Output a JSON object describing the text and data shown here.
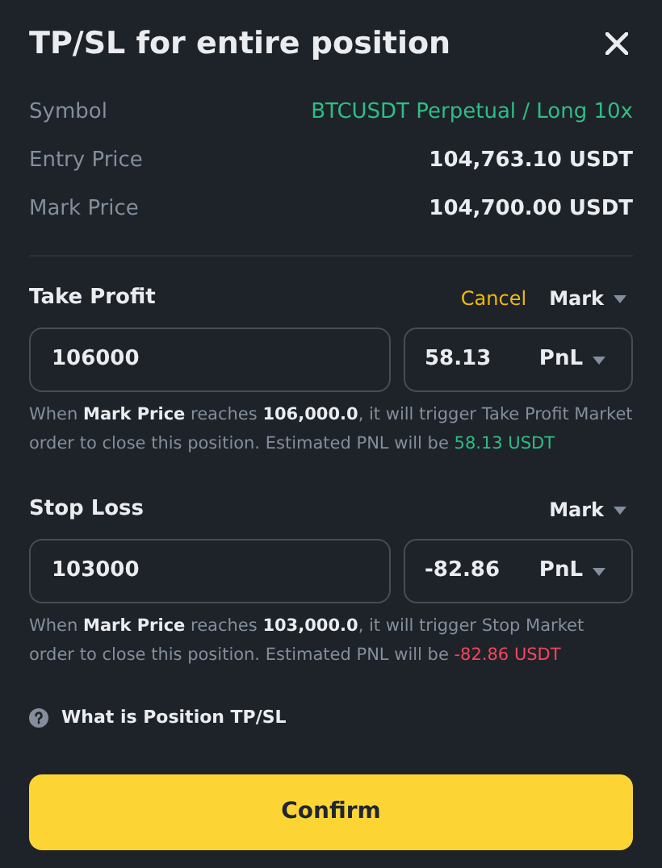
{
  "title": "TP/SL for entire position",
  "info": [
    {
      "label": "Symbol",
      "value": "BTCUSDT Perpetual / Long 10x",
      "kind": "symbol",
      "color": "#2ebd85"
    },
    {
      "label": "Entry Price",
      "value": "104,763.10 USDT",
      "kind": "amount",
      "color": "#eaecef"
    },
    {
      "label": "Mark Price",
      "value": "104,700.00 USDT",
      "kind": "amount",
      "color": "#eaecef"
    }
  ],
  "sections": [
    {
      "title": "Take Profit",
      "cancel": "Cancel",
      "trigger": "Mark",
      "price": "106000",
      "pnl_input": "58.13",
      "pnl_unit": "PnL",
      "description": "When **Mark Price** reaches **106,000.0**, it will trigger Take Profit Market order to close this position. Estimated PNL will be",
      "pnl": "58.13 USDT",
      "color": "#2ebd85"
    },
    {
      "title": "Stop Loss",
      "trigger": "Mark",
      "price": "103000",
      "pnl_input": "-82.86",
      "pnl_unit": "PnL",
      "description": "When **Mark Price** reaches **103,000.0**, it will trigger Stop Market order to close this position. Estimated PNL will be",
      "pnl": "-82.86 USDT",
      "color": "#f6465d"
    }
  ],
  "help": "What is Position TP/SL",
  "confirm": "Confirm"
}
